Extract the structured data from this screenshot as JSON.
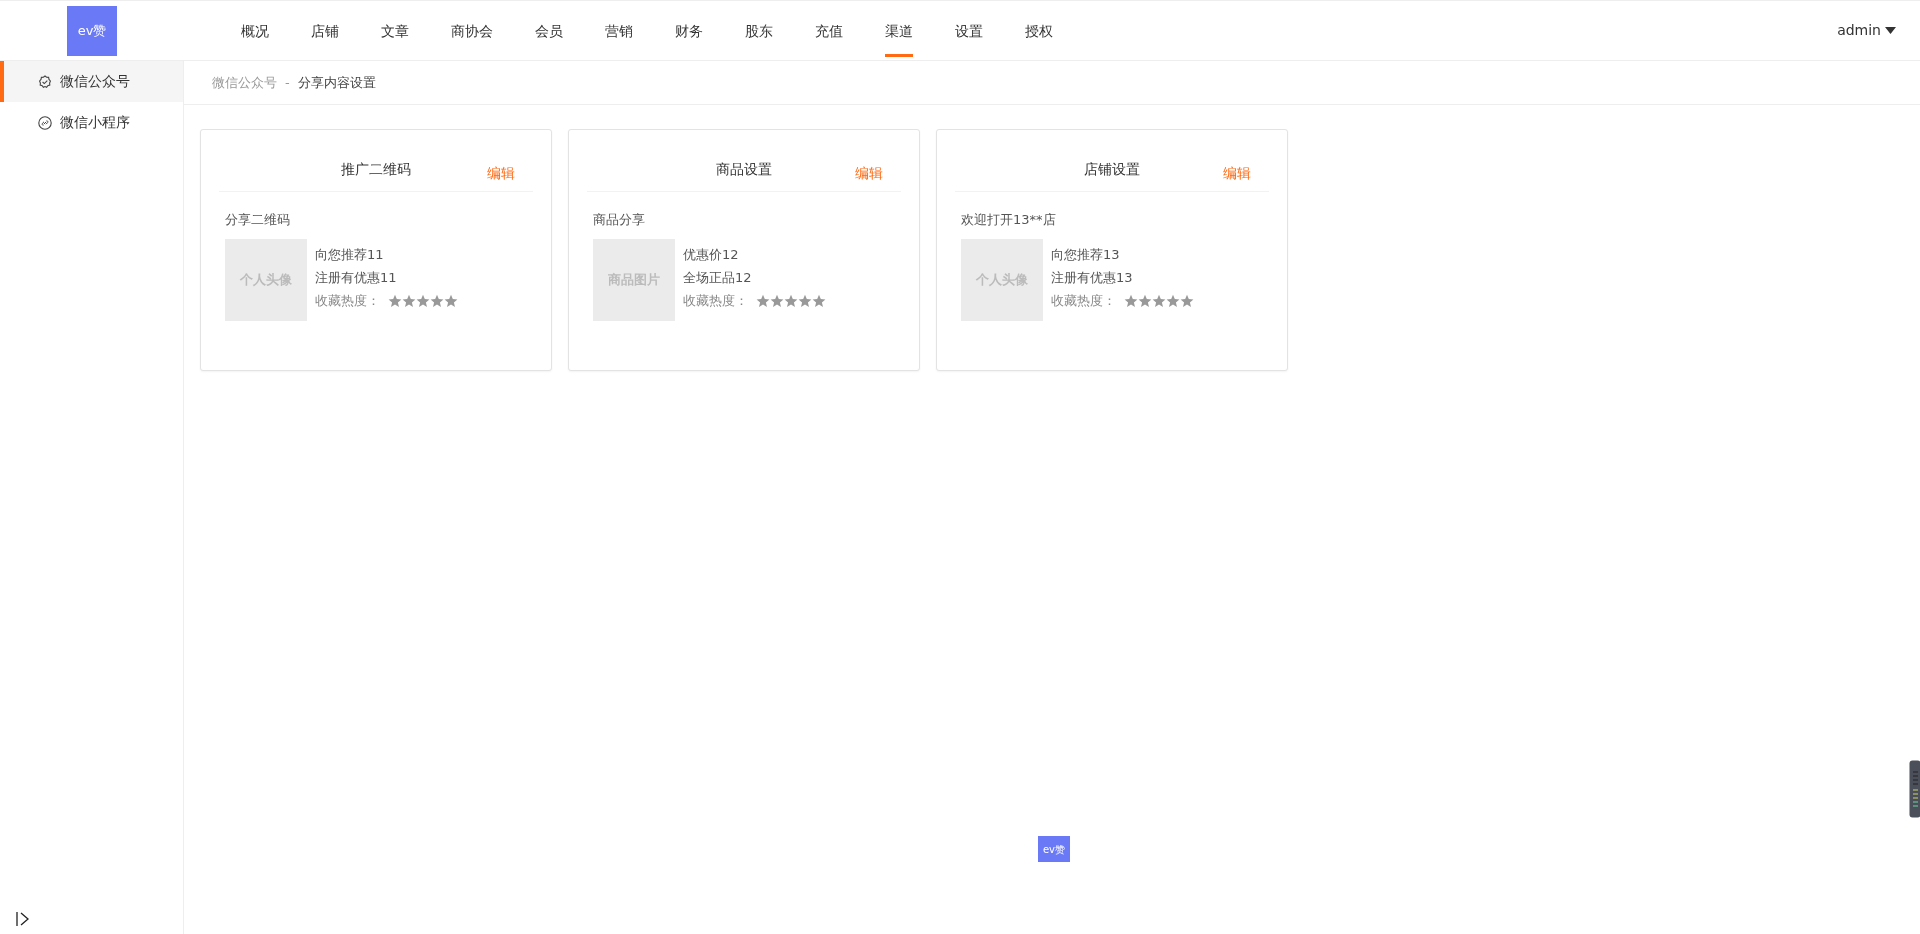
{
  "header": {
    "logo_text": "ev赞",
    "nav": [
      {
        "label": "概况",
        "selected": false
      },
      {
        "label": "店铺",
        "selected": false
      },
      {
        "label": "文章",
        "selected": false
      },
      {
        "label": "商协会",
        "selected": false
      },
      {
        "label": "会员",
        "selected": false
      },
      {
        "label": "营销",
        "selected": false
      },
      {
        "label": "财务",
        "selected": false
      },
      {
        "label": "股东",
        "selected": false
      },
      {
        "label": "充值",
        "selected": false
      },
      {
        "label": "渠道",
        "selected": true
      },
      {
        "label": "设置",
        "selected": false
      },
      {
        "label": "授权",
        "selected": false
      }
    ],
    "user": "admin"
  },
  "sidebar": {
    "items": [
      {
        "label": "微信公众号",
        "kind": "badge",
        "selected": true
      },
      {
        "label": "微信小程序",
        "kind": "link",
        "selected": false
      }
    ]
  },
  "breadcrumb": [
    "微信公众号",
    "-",
    "分享内容设置"
  ],
  "cards": [
    {
      "title": "推广二维码",
      "edit": "编辑",
      "subtitle": "分享二维码",
      "image": "个人头像",
      "lines": [
        "向您推荐11",
        "注册有优惠11"
      ],
      "rating_label": "收藏热度：",
      "stars": 5
    },
    {
      "title": "商品设置",
      "edit": "编辑",
      "subtitle": "商品分享",
      "image": "商品图片",
      "lines": [
        "优惠价12",
        "全场正品12"
      ],
      "rating_label": "收藏热度：",
      "stars": 5
    },
    {
      "title": "店铺设置",
      "edit": "编辑",
      "subtitle": "欢迎打开13**店",
      "image": "个人头像",
      "lines": [
        "向您推荐13",
        "注册有优惠13"
      ],
      "rating_label": "收藏热度：",
      "stars": 5
    }
  ],
  "floating_logo_text": "ev赞"
}
